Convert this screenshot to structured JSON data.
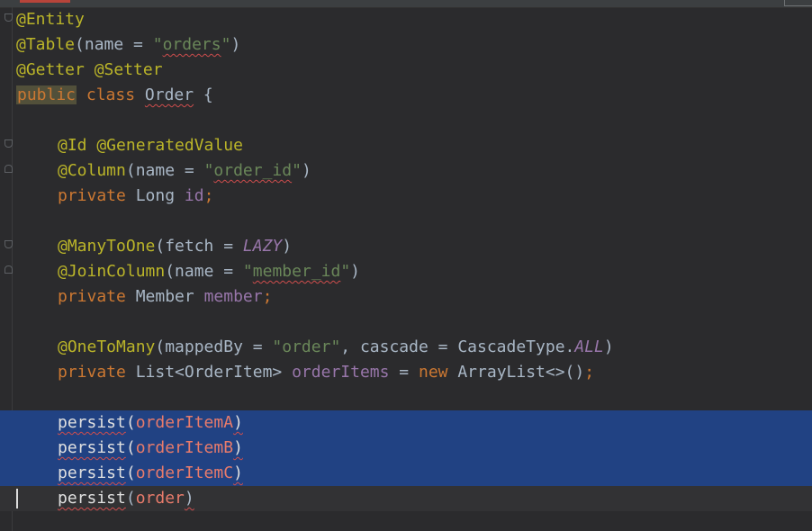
{
  "editor": {
    "lines": {
      "l1": {
        "a": "@Entity"
      },
      "l2": {
        "a": "@Table",
        "b": "(name = ",
        "c": "\"",
        "d": "orders",
        "e": "\"",
        "f": ")"
      },
      "l3": {
        "a": "@Getter @Setter"
      },
      "l4": {
        "a": "public",
        "b": " class ",
        "c": "Order",
        "d": " {"
      },
      "l6": {
        "a": "@Id @GeneratedValue"
      },
      "l7": {
        "a": "@Column",
        "b": "(name = ",
        "c": "\"",
        "d": "order_id",
        "e": "\"",
        "f": ")"
      },
      "l8": {
        "a": "private ",
        "b": "Long ",
        "c": "id",
        "d": ";"
      },
      "l10": {
        "a": "@ManyToOne",
        "b": "(fetch = ",
        "c": "LAZY",
        "d": ")"
      },
      "l11": {
        "a": "@JoinColumn",
        "b": "(name = ",
        "c": "\"",
        "d": "member_id",
        "e": "\"",
        "f": ")"
      },
      "l12": {
        "a": "private ",
        "b": "Member ",
        "c": "member",
        "d": ";"
      },
      "l14": {
        "a": "@OneToMany",
        "b": "(mappedBy = ",
        "c": "\"order\"",
        "d": ", cascade = CascadeType.",
        "e": "ALL",
        "f": ")"
      },
      "l15": {
        "a": "private ",
        "b": "List<OrderItem> ",
        "c": "orderItems",
        "d": " = ",
        "e": "new ",
        "f": "ArrayList<>()",
        "g": ";"
      },
      "l17": {
        "a": "persist",
        "b": "(",
        "c": "orderItemA",
        "d": ")"
      },
      "l18": {
        "a": "persist",
        "b": "(",
        "c": "orderItemB",
        "d": ")"
      },
      "l19": {
        "a": "persist",
        "b": "(",
        "c": "orderItemC",
        "d": ")"
      },
      "l20": {
        "a": "persist",
        "b": "(",
        "c": "order",
        "d": ")"
      }
    }
  },
  "colors": {
    "background": "#2b2b2d",
    "selection": "#214283",
    "annotation": "#bbb529",
    "keyword": "#cc7832",
    "string": "#6a8759",
    "field": "#9876aa",
    "error_underline": "#cf4d4d"
  }
}
